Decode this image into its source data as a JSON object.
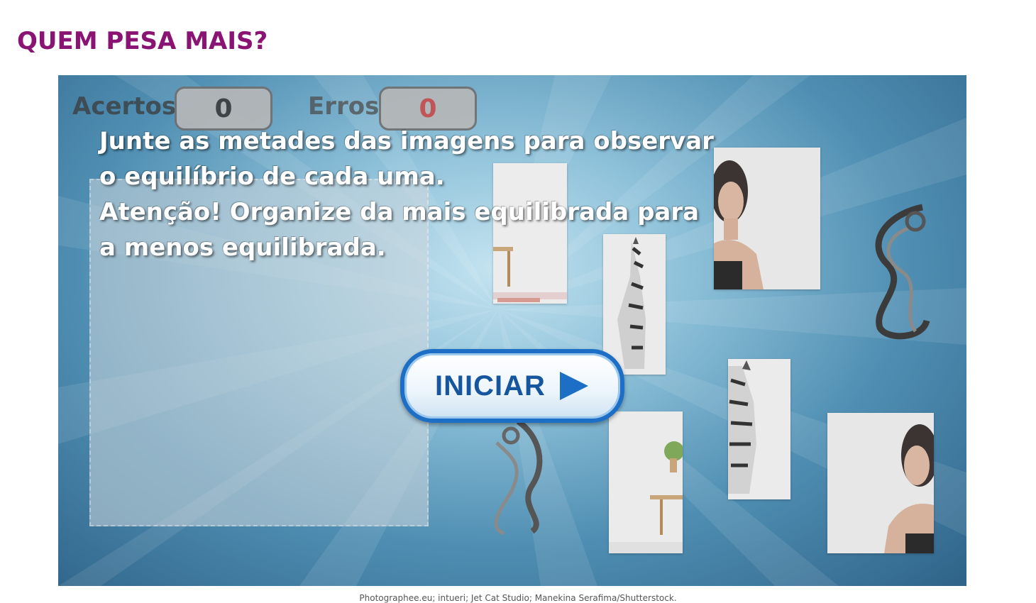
{
  "page": {
    "title": "QUEM PESA MAIS?"
  },
  "hud": {
    "hits_label": "Acertos",
    "hits_value": "0",
    "errors_label": "Erros",
    "errors_value": "0",
    "hits_color": "#3a3a3a",
    "errors_color": "#c94a4a"
  },
  "instructions": {
    "lines": [
      "Junte as metades das imagens para observar",
      "o equilíbrio de cada uma.",
      "Atenção! Organize da mais equilibrada para",
      "a menos equilibrada."
    ]
  },
  "start_button": {
    "label": "INICIAR",
    "icon": "play-icon"
  },
  "pieces": [
    {
      "name": "chair-half-top",
      "icon": "chair-icon"
    },
    {
      "name": "zebra-half-right",
      "icon": "zebra-icon"
    },
    {
      "name": "woman-half-left",
      "icon": "woman-icon"
    },
    {
      "name": "knot-half-right",
      "icon": "celtic-knot-icon"
    },
    {
      "name": "knot-half-left",
      "icon": "celtic-knot-icon"
    },
    {
      "name": "chair-half-bottom",
      "icon": "chair-icon"
    },
    {
      "name": "zebra-half-left",
      "icon": "zebra-icon"
    },
    {
      "name": "woman-half-right",
      "icon": "woman-icon"
    }
  ],
  "credits": "Photographee.eu; intueri; Jet Cat Studio; Manekina Serafima/Shutterstock.",
  "colors": {
    "title": "#8a1473",
    "button_border": "#1c6fc4",
    "button_text": "#15569f"
  }
}
